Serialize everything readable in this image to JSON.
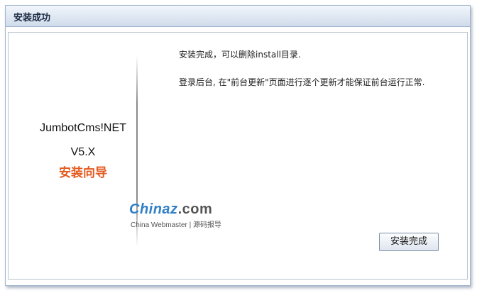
{
  "window": {
    "title": "安装成功"
  },
  "left_panel": {
    "product_name": "JumbotCms!NET",
    "version": "V5.X",
    "wizard_label": "安装向导"
  },
  "watermark": {
    "brand": "Chinaz",
    "domain": ".com",
    "tagline": "China Webmaster | 源码报导"
  },
  "messages": {
    "line1": "安装完成，可以删除install目录.",
    "line2": "登录后台, 在\"前台更新\"页面进行逐个更新才能保证前台运行正常."
  },
  "buttons": {
    "finish_label": "安装完成"
  },
  "colors": {
    "title_bar_top": "#f2f6fb",
    "title_bar_bottom": "#cfdceb",
    "accent_orange": "#e25a1f",
    "logo_blue": "#2f7fc7"
  }
}
